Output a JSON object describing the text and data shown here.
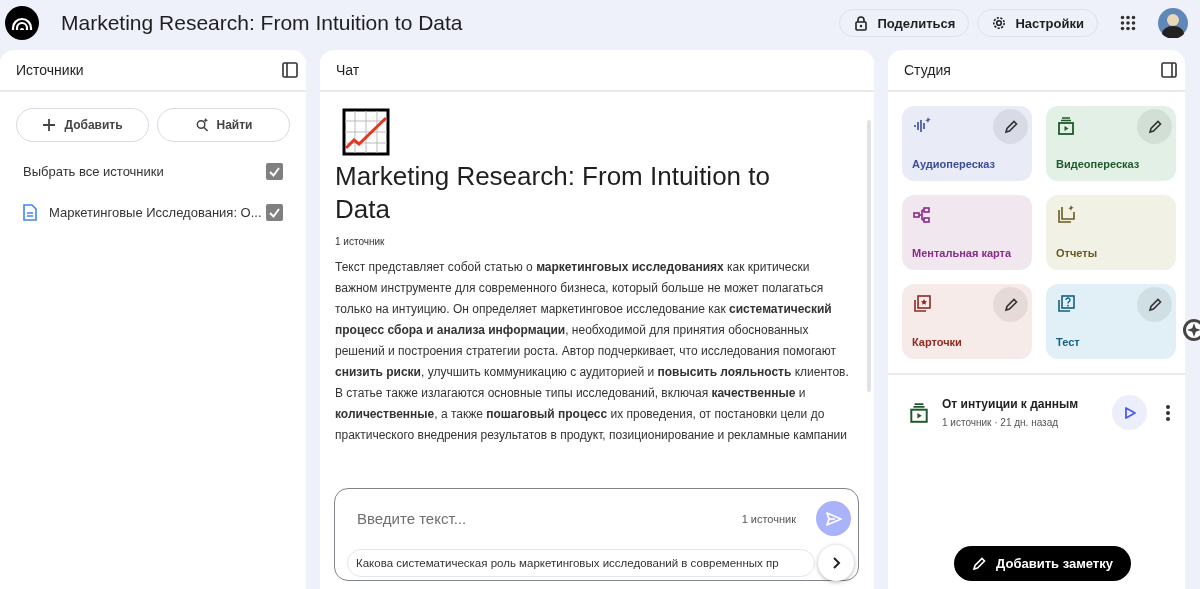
{
  "header": {
    "title": "Marketing Research: From Intuition to Data",
    "buttons": [
      {
        "kind": "share",
        "label": "Поделиться"
      },
      {
        "kind": "settings",
        "label": "Настройки"
      }
    ]
  },
  "sources": {
    "title": "Источники",
    "buttons": [
      {
        "kind": "add",
        "label": "Добавить"
      },
      {
        "kind": "discover",
        "label": "Найти"
      }
    ],
    "select_all": {
      "label": "Выбрать все источники",
      "checked": true
    },
    "items": [
      {
        "label": "Маркетинговые Исследования: О...",
        "checked": true
      }
    ]
  },
  "chat": {
    "title": "Чат",
    "note_title": "Marketing Research: From Intuition to Data",
    "source_count": "1 источник",
    "summary": "Текст представляет собой статью о **маркетинговых исследованиях** как критически важном инструменте для современного бизнеса, который больше не может полагаться только на интуицию. Он определяет маркетинговое исследование как **систематический процесс сбора и анализа информации**, необходимой для принятия обоснованных решений и построения стратегии роста. Автор подчеркивает, что исследования помогают **снизить риски**, улучшить коммуникацию с аудиторией и **повысить лояльность** клиентов. В статье также излагаются основные типы исследований, включая **качественные** и **количественные**, а также **пошаговый процесс** их проведения, от постановки цели до практического внедрения результатов в продукт, позиционирование и рекламные кампании",
    "input": {
      "placeholder": "Введите текст...",
      "source_count": "1 источник"
    },
    "suggestion": "Какова систематическая роль маркетинговых исследований в современных пр"
  },
  "studio": {
    "title": "Студия",
    "tiles": [
      {
        "kind": "audio",
        "label": "Аудиопересказ",
        "color": "#e9ebf7",
        "editable": true
      },
      {
        "kind": "video",
        "label": "Видеопересказ",
        "color": "#e2f0e6",
        "editable": true
      },
      {
        "kind": "mindmap",
        "label": "Ментальная карта",
        "color": "#f1e8ef",
        "editable": false
      },
      {
        "kind": "reports",
        "label": "Отчеты",
        "color": "#f1f1e6",
        "editable": false
      },
      {
        "kind": "cards",
        "label": "Карточки",
        "color": "#f7ebe9",
        "editable": true
      },
      {
        "kind": "quiz",
        "label": "Тест",
        "color": "#e0f0f6",
        "editable": true
      }
    ],
    "outputs": [
      {
        "kind": "video",
        "title": "От интуиции к данным",
        "meta": "1 источник · 21 дн. назад"
      }
    ],
    "add_note": "Добавить заметку"
  }
}
